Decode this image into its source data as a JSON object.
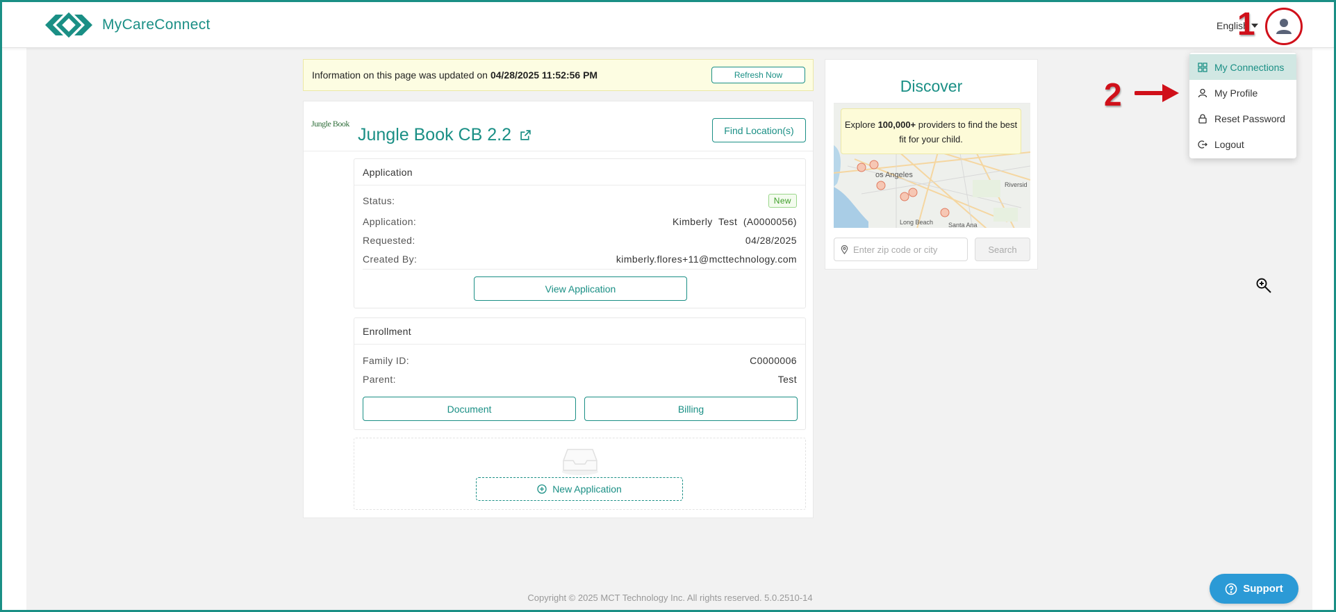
{
  "header": {
    "app_name": "MyCareConnect",
    "language": "English"
  },
  "annotations": {
    "step1": "1",
    "step2": "2"
  },
  "user_menu": {
    "items": [
      {
        "label": "My Connections",
        "icon": "grid-icon",
        "active": true
      },
      {
        "label": "My Profile",
        "icon": "user-icon",
        "active": false
      },
      {
        "label": "Reset Password",
        "icon": "lock-icon",
        "active": false
      },
      {
        "label": "Logout",
        "icon": "logout-icon",
        "active": false
      }
    ]
  },
  "banner": {
    "text": "Information on this page was updated on",
    "timestamp": "04/28/2025 11:52:56 PM",
    "refresh_label": "Refresh Now"
  },
  "provider": {
    "logo_text": "Jungle Book",
    "name": "Jungle Book CB 2.2",
    "find_label": "Find Location(s)"
  },
  "application": {
    "title": "Application",
    "status_label": "Status:",
    "status_value": "New",
    "application_label": "Application:",
    "application_value": "Kimberly  Test  (A0000056)",
    "requested_label": "Requested:",
    "requested_value": "04/28/2025",
    "created_by_label": "Created By:",
    "created_by_value": "kimberly.flores+11@mcttechnology.com",
    "view_label": "View Application"
  },
  "enrollment": {
    "title": "Enrollment",
    "family_label": "Family ID:",
    "family_value": "C0000006",
    "parent_label": "Parent:",
    "parent_value": "Test",
    "document_label": "Document",
    "billing_label": "Billing"
  },
  "new_application_label": "New Application",
  "discover": {
    "title": "Discover",
    "tip_pre": "Explore",
    "tip_bold": "100,000+",
    "tip_post": "providers to find the best fit for your child.",
    "zip_placeholder": "Enter zip code or city",
    "search_label": "Search",
    "map_labels": [
      "os Angeles",
      "Long Beach",
      "Santa Ana",
      "Riversid"
    ]
  },
  "footer": "Copyright © 2025 MCT Technology Inc. All rights reserved. 5.0.2510-14",
  "support_label": "Support",
  "colors": {
    "brand": "#1a8f85",
    "annotation": "#d0101a",
    "banner_bg": "#fdfde2",
    "support": "#2b9ad6"
  }
}
